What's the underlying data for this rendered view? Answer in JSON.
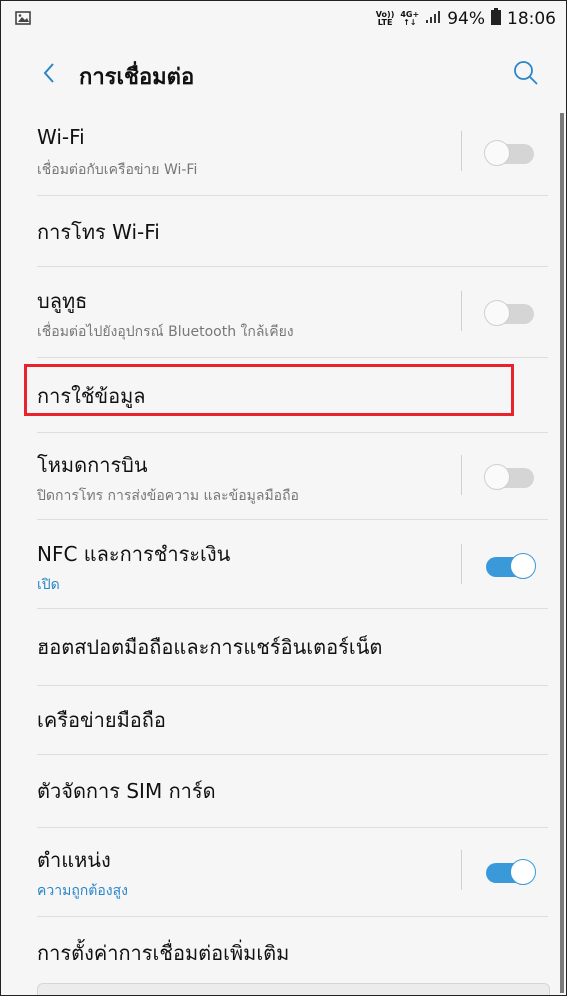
{
  "status_bar": {
    "volte_top": "Vo))",
    "volte_bottom": "LTE",
    "network_top": "4G+",
    "network_bottom": "↑↓",
    "battery": "94%",
    "time": "18:06"
  },
  "header": {
    "title": "การเชื่อมต่อ"
  },
  "items": [
    {
      "title": "Wi-Fi",
      "subtitle": "เชื่อมต่อกับเครือข่าย Wi-Fi",
      "toggle": "off"
    },
    {
      "title": "การโทร Wi-Fi"
    },
    {
      "title": "บลูทูธ",
      "subtitle": "เชื่อมต่อไปยังอุปกรณ์ Bluetooth ใกล้เคียง",
      "toggle": "off"
    },
    {
      "title": "การใช้ข้อมูล"
    },
    {
      "title": "โหมดการบิน",
      "subtitle": "ปิดการโทร การส่งข้อความ และข้อมูลมือถือ",
      "toggle": "off"
    },
    {
      "title": "NFC และการชำระเงิน",
      "subtitle": "เปิด",
      "toggle": "on"
    },
    {
      "title": "ฮอตสปอตมือถือและการแชร์อินเตอร์เน็ต"
    },
    {
      "title": "เครือข่ายมือถือ"
    },
    {
      "title": "ตัวจัดการ SIM การ์ด"
    },
    {
      "title": "ตำแหน่ง",
      "subtitle": "ความถูกต้องสูง",
      "toggle": "on"
    },
    {
      "title": "การตั้งค่าการเชื่อมต่อเพิ่มเติม"
    }
  ],
  "colors": {
    "accent": "#3a9ad9",
    "highlight": "#e8232b",
    "subtitle_on": "#2a86c8"
  },
  "icons": {
    "gallery": "image-icon",
    "back": "chevron-left-icon",
    "search": "search-icon"
  }
}
